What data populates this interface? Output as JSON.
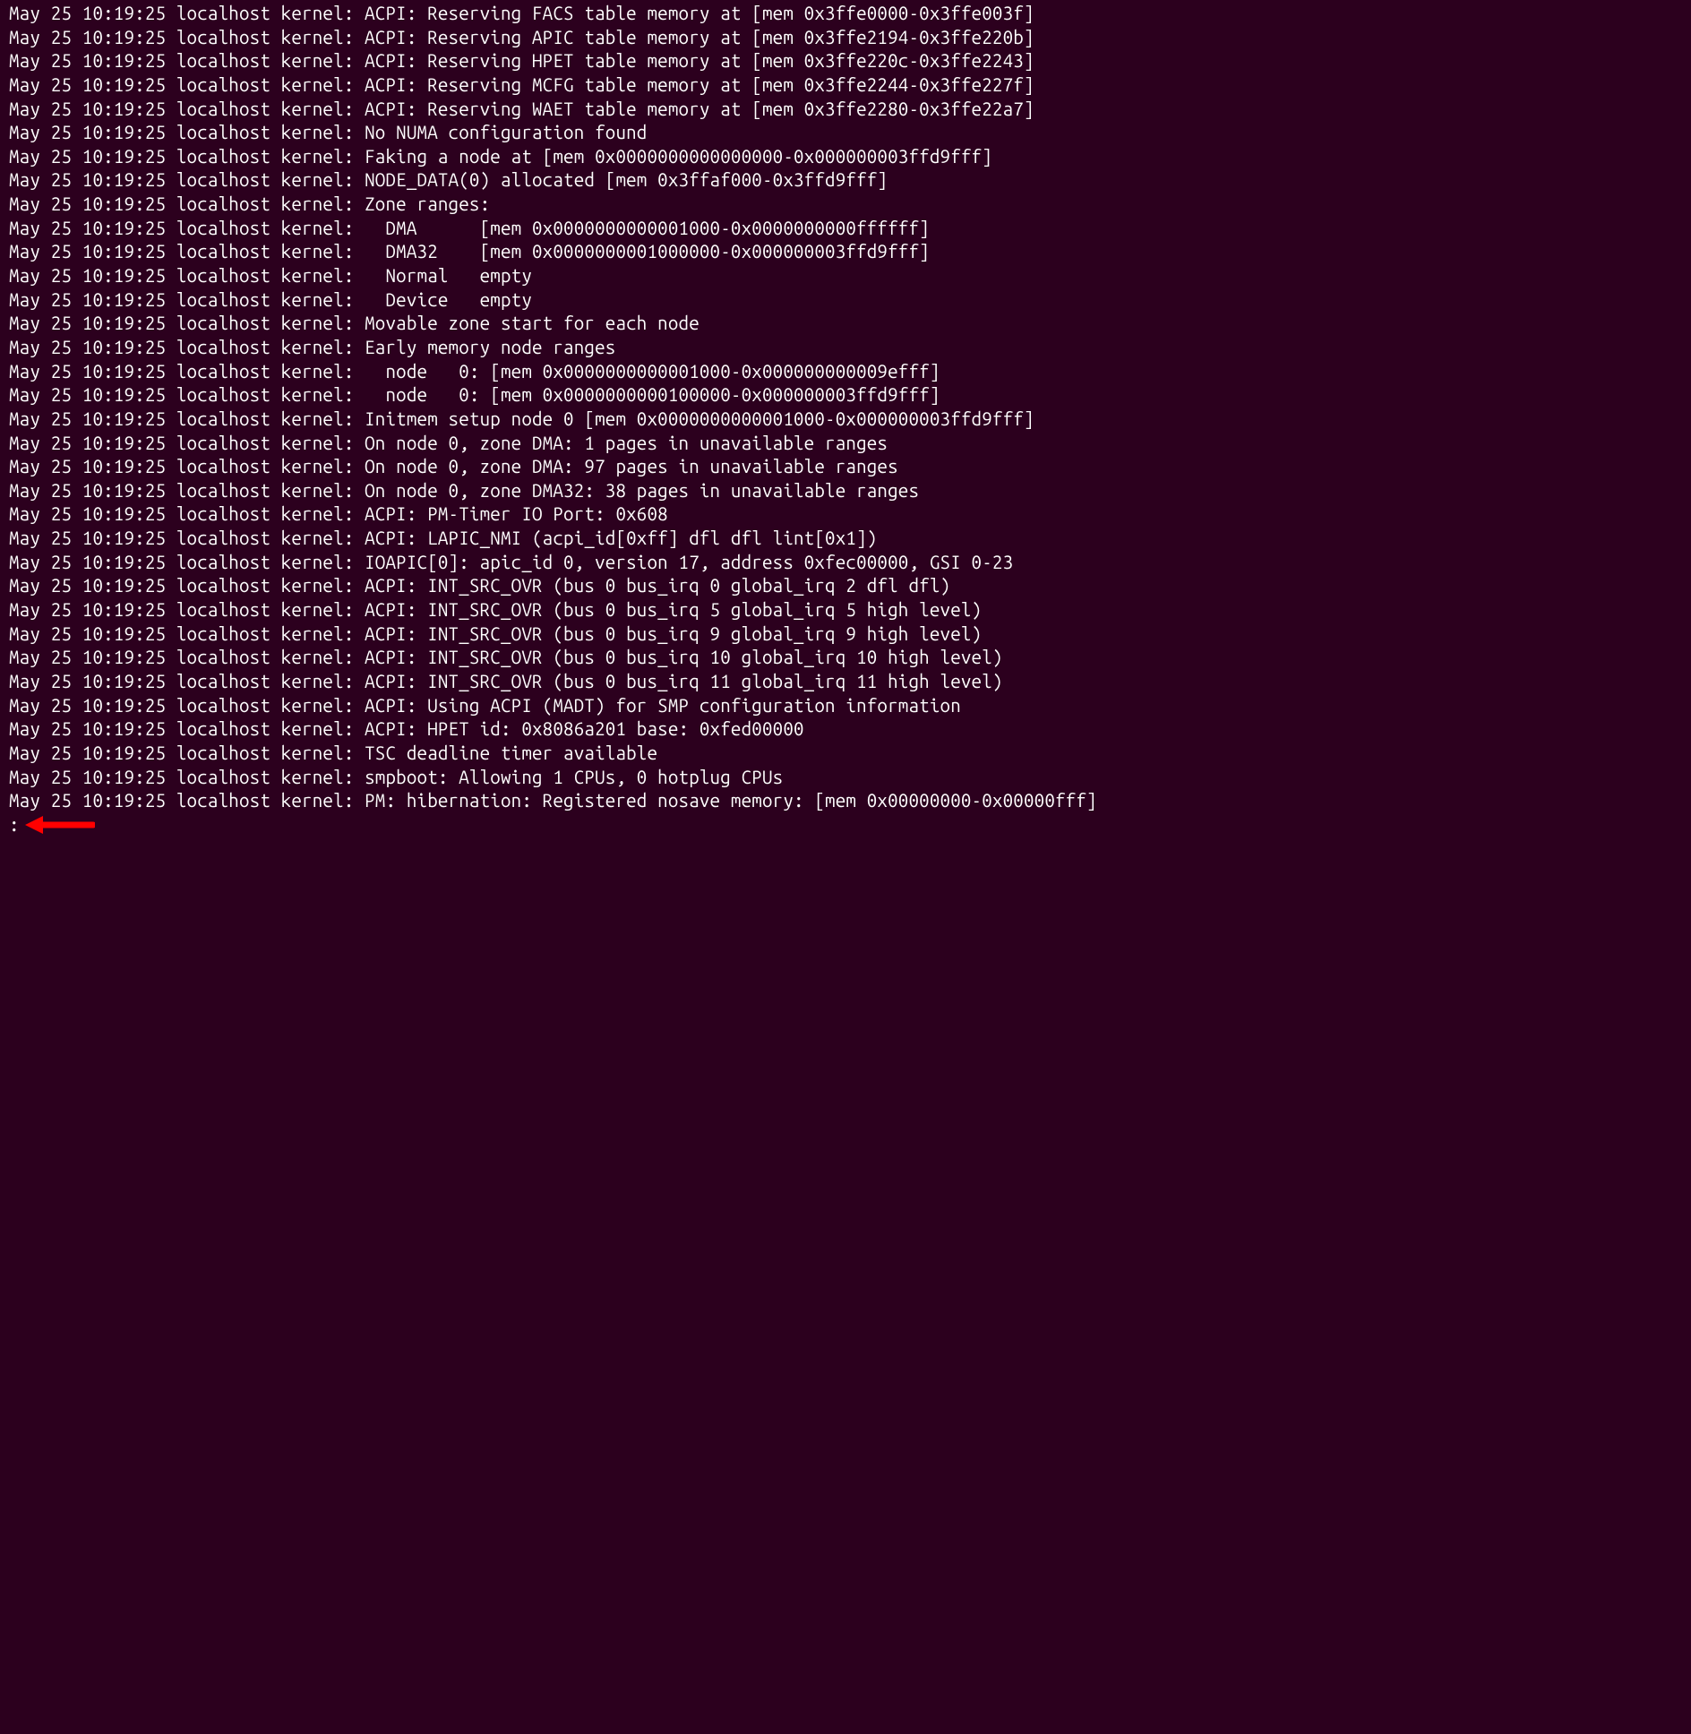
{
  "terminal": {
    "lines": [
      "May 25 10:19:25 localhost kernel: ACPI: Reserving FACS table memory at [mem 0x3ffe0000-0x3ffe003f]",
      "May 25 10:19:25 localhost kernel: ACPI: Reserving APIC table memory at [mem 0x3ffe2194-0x3ffe220b]",
      "May 25 10:19:25 localhost kernel: ACPI: Reserving HPET table memory at [mem 0x3ffe220c-0x3ffe2243]",
      "May 25 10:19:25 localhost kernel: ACPI: Reserving MCFG table memory at [mem 0x3ffe2244-0x3ffe227f]",
      "May 25 10:19:25 localhost kernel: ACPI: Reserving WAET table memory at [mem 0x3ffe2280-0x3ffe22a7]",
      "May 25 10:19:25 localhost kernel: No NUMA configuration found",
      "May 25 10:19:25 localhost kernel: Faking a node at [mem 0x0000000000000000-0x000000003ffd9fff]",
      "May 25 10:19:25 localhost kernel: NODE_DATA(0) allocated [mem 0x3ffaf000-0x3ffd9fff]",
      "May 25 10:19:25 localhost kernel: Zone ranges:",
      "May 25 10:19:25 localhost kernel:   DMA      [mem 0x0000000000001000-0x0000000000ffffff]",
      "May 25 10:19:25 localhost kernel:   DMA32    [mem 0x0000000001000000-0x000000003ffd9fff]",
      "May 25 10:19:25 localhost kernel:   Normal   empty",
      "May 25 10:19:25 localhost kernel:   Device   empty",
      "May 25 10:19:25 localhost kernel: Movable zone start for each node",
      "May 25 10:19:25 localhost kernel: Early memory node ranges",
      "May 25 10:19:25 localhost kernel:   node   0: [mem 0x0000000000001000-0x000000000009efff]",
      "May 25 10:19:25 localhost kernel:   node   0: [mem 0x0000000000100000-0x000000003ffd9fff]",
      "May 25 10:19:25 localhost kernel: Initmem setup node 0 [mem 0x0000000000001000-0x000000003ffd9fff]",
      "May 25 10:19:25 localhost kernel: On node 0, zone DMA: 1 pages in unavailable ranges",
      "May 25 10:19:25 localhost kernel: On node 0, zone DMA: 97 pages in unavailable ranges",
      "May 25 10:19:25 localhost kernel: On node 0, zone DMA32: 38 pages in unavailable ranges",
      "May 25 10:19:25 localhost kernel: ACPI: PM-Timer IO Port: 0x608",
      "May 25 10:19:25 localhost kernel: ACPI: LAPIC_NMI (acpi_id[0xff] dfl dfl lint[0x1])",
      "May 25 10:19:25 localhost kernel: IOAPIC[0]: apic_id 0, version 17, address 0xfec00000, GSI 0-23",
      "May 25 10:19:25 localhost kernel: ACPI: INT_SRC_OVR (bus 0 bus_irq 0 global_irq 2 dfl dfl)",
      "May 25 10:19:25 localhost kernel: ACPI: INT_SRC_OVR (bus 0 bus_irq 5 global_irq 5 high level)",
      "May 25 10:19:25 localhost kernel: ACPI: INT_SRC_OVR (bus 0 bus_irq 9 global_irq 9 high level)",
      "May 25 10:19:25 localhost kernel: ACPI: INT_SRC_OVR (bus 0 bus_irq 10 global_irq 10 high level)",
      "May 25 10:19:25 localhost kernel: ACPI: INT_SRC_OVR (bus 0 bus_irq 11 global_irq 11 high level)",
      "May 25 10:19:25 localhost kernel: ACPI: Using ACPI (MADT) for SMP configuration information",
      "May 25 10:19:25 localhost kernel: ACPI: HPET id: 0x8086a201 base: 0xfed00000",
      "May 25 10:19:25 localhost kernel: TSC deadline timer available",
      "May 25 10:19:25 localhost kernel: smpboot: Allowing 1 CPUs, 0 hotplug CPUs",
      "May 25 10:19:25 localhost kernel: PM: hibernation: Registered nosave memory: [mem 0x00000000-0x00000fff]"
    ],
    "prompt": ":"
  },
  "annotation": {
    "arrow_color": "#ff0000"
  }
}
